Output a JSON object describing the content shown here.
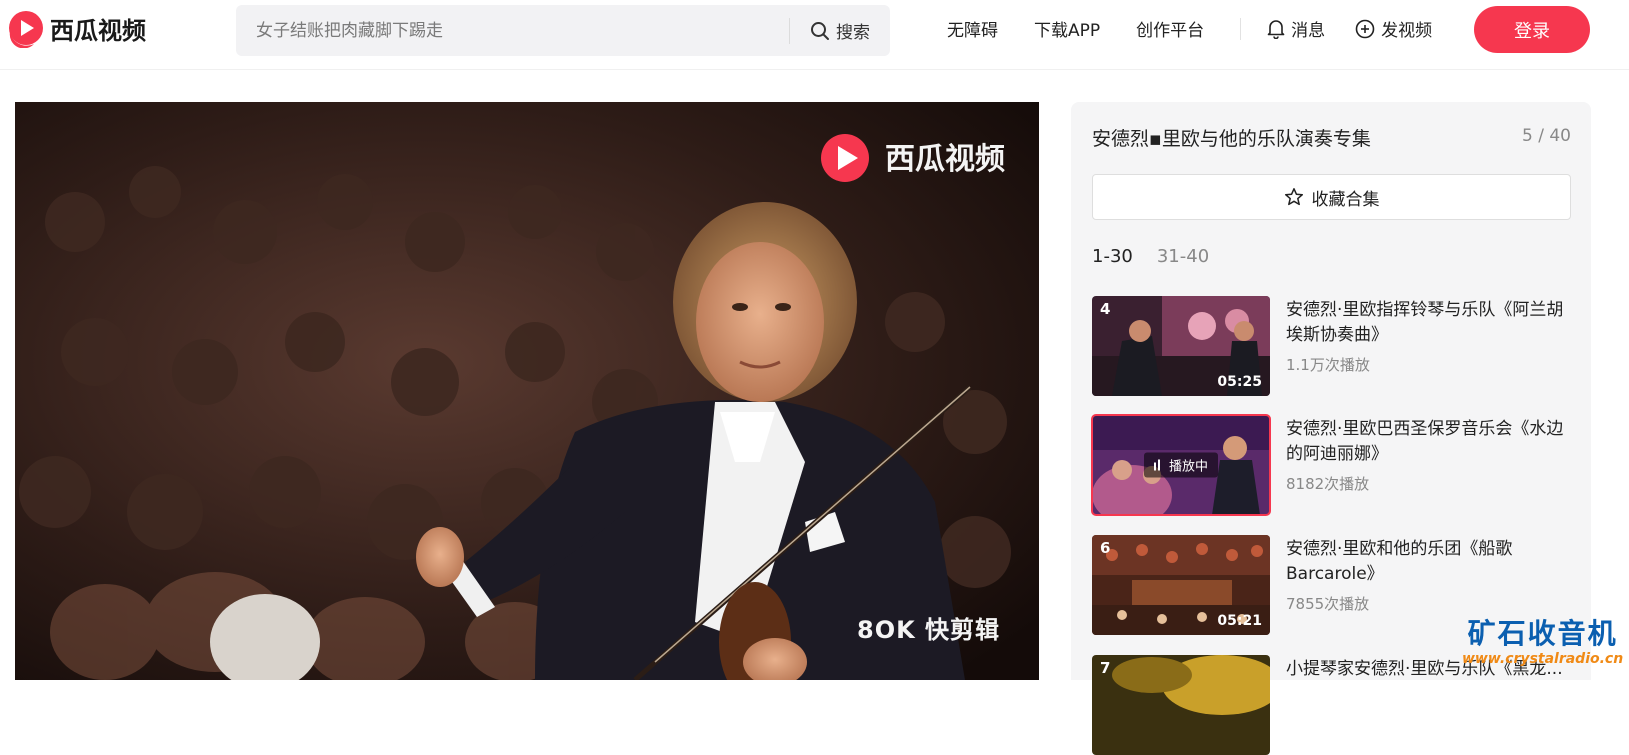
{
  "header": {
    "logo_text": "西瓜视频",
    "search_placeholder": "女子结账把肉藏脚下踢走",
    "search_button": "搜索",
    "nav": {
      "accessibility": "无障碍",
      "download_app": "下载APP",
      "creator_platform": "创作平台",
      "messages": "消息",
      "upload_video": "发视频"
    },
    "login_button": "登录",
    "brand_color": "#f6374f"
  },
  "player": {
    "watermark_top": "西瓜视频",
    "watermark_bottom": "8OK 快剪辑"
  },
  "playlist": {
    "title": "安德烈▪里欧与他的乐队演奏专集",
    "position": "5 / 40",
    "collect_button": "收藏合集",
    "ranges": [
      {
        "label": "1-30",
        "active": true
      },
      {
        "label": "31-40",
        "active": false
      }
    ],
    "items": [
      {
        "index": "4",
        "title": "安德烈·里欧指挥铃琴与乐队《阿兰胡埃斯协奏曲》",
        "plays": "1.1万次播放",
        "duration": "05:25",
        "playing": false
      },
      {
        "index": "5",
        "title": "安德烈·里欧巴西圣保罗音乐会《水边的阿迪丽娜》",
        "plays": "8182次播放",
        "duration": "",
        "playing": true,
        "playing_label": "播放中"
      },
      {
        "index": "6",
        "title": "安德烈·里欧和他的乐团《船歌Barcarole》",
        "plays": "7855次播放",
        "duration": "05:21",
        "playing": false
      },
      {
        "index": "7",
        "title": "小提琴家安德烈·里欧与乐队《黑龙...",
        "plays": "",
        "duration": "",
        "playing": false
      }
    ]
  },
  "site_watermark": {
    "cn": "矿石收音机",
    "url": "www.crystalradio.cn"
  }
}
